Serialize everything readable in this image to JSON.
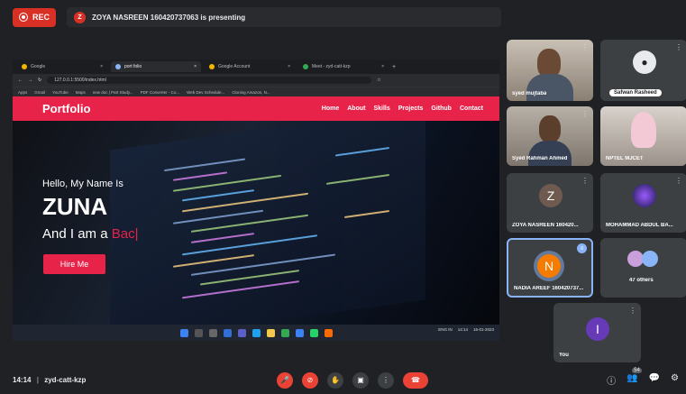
{
  "topbar": {
    "rec_label": "REC",
    "presenter_initial": "Z",
    "presenting_text": "ZOYA NASREEN 160420737063 is presenting"
  },
  "browser": {
    "tabs": [
      {
        "label": "Google"
      },
      {
        "label": "port folio"
      },
      {
        "label": "Google Account"
      },
      {
        "label": "Meet - zyd-catt-kzp"
      }
    ],
    "url": "127.0.0.1:5500/index.html",
    "bookmarks": [
      "Apps",
      "Gmail",
      "YouTube",
      "Maps",
      "new doc | Part Study...",
      "PDF Converter - Co...",
      "Web Dev Schedule...",
      "Cloning Amazon, N..."
    ]
  },
  "site": {
    "brand": "Portfolio",
    "nav": [
      "Home",
      "About",
      "Skills",
      "Projects",
      "Github",
      "Contact"
    ],
    "hello": "Hello, My Name Is",
    "name": "ZUNA",
    "iam_prefix": "And I am a ",
    "iam_typed": "Bac|",
    "hire_label": "Hire Me"
  },
  "taskbar": {
    "lang": "ENG IN",
    "time": "14:14",
    "date": "16-01-2023"
  },
  "participants": [
    {
      "name": "syed mujtaba"
    },
    {
      "name": "Safwan Rasheed"
    },
    {
      "name": "Syed Rahman Ahmed"
    },
    {
      "name": "NPTEL MJCET"
    },
    {
      "name": "ZOYA NASREEN 160420...",
      "initial": "Z"
    },
    {
      "name": "MOHAMMAD ABDUL BA..."
    },
    {
      "name": "NADIA AREEF 160420737...",
      "initial": "N"
    },
    {
      "name": "47 others"
    },
    {
      "name": "You",
      "initial": "I"
    }
  ],
  "bottom": {
    "time": "14:14",
    "separator": "|",
    "meeting_code": "zyd-catt-kzp",
    "participant_count": "54"
  },
  "colors": {
    "accent": "#e8234a",
    "rec": "#d93025",
    "background": "#202124",
    "tile": "#3c4043",
    "active_speaker": "#8ab4f8"
  }
}
